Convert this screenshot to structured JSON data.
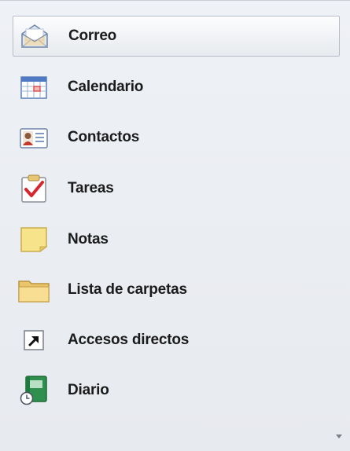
{
  "nav": {
    "items": [
      {
        "label": "Correo",
        "icon": "mail-envelope-icon",
        "selected": true
      },
      {
        "label": "Calendario",
        "icon": "calendar-icon",
        "selected": false
      },
      {
        "label": "Contactos",
        "icon": "contact-card-icon",
        "selected": false
      },
      {
        "label": "Tareas",
        "icon": "task-clipboard-icon",
        "selected": false
      },
      {
        "label": "Notas",
        "icon": "sticky-note-icon",
        "selected": false
      },
      {
        "label": "Lista de carpetas",
        "icon": "folder-icon",
        "selected": false
      },
      {
        "label": "Accesos directos",
        "icon": "shortcut-arrow-icon",
        "selected": false
      },
      {
        "label": "Diario",
        "icon": "journal-clock-icon",
        "selected": false
      }
    ]
  },
  "colors": {
    "panel_background": "#e9ecf1",
    "selected_border": "#b7bdc6",
    "text": "#1b1b1b"
  }
}
